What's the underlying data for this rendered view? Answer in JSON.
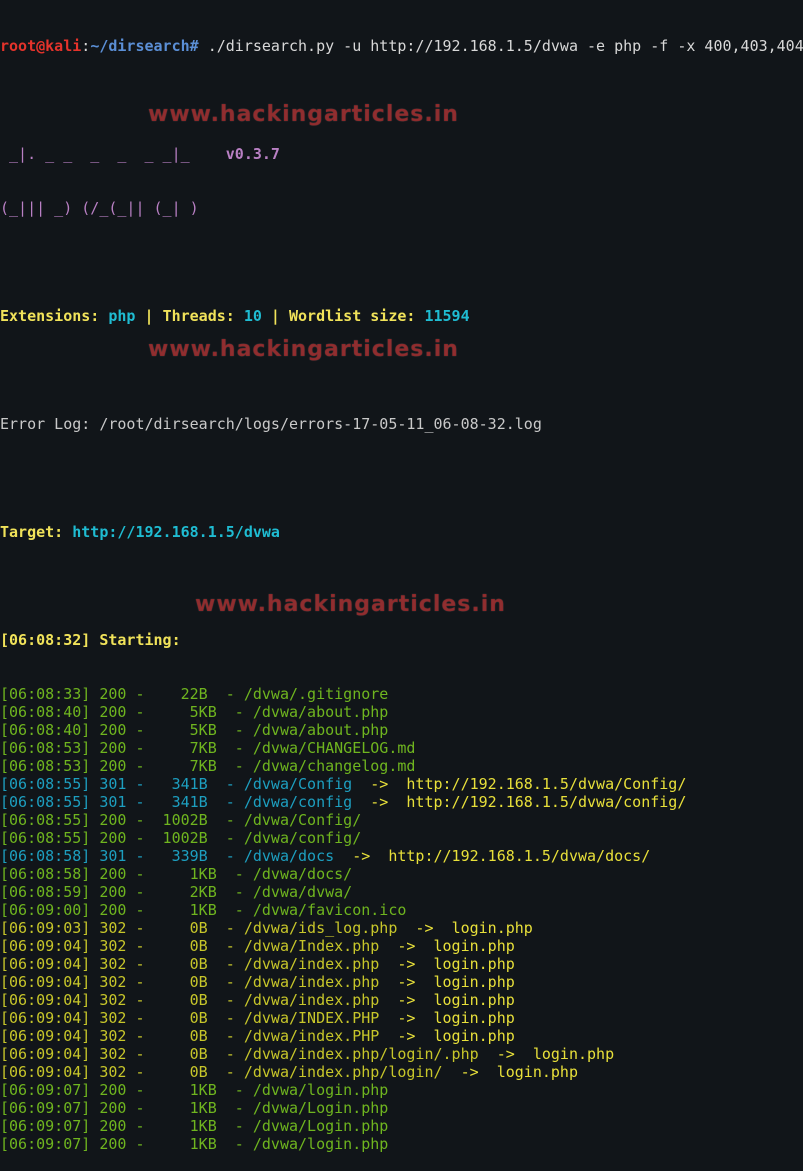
{
  "prompt": {
    "user": "root@kali",
    "sep": ":",
    "path": "~/dirsearch",
    "symbol": "#",
    "command": " ./dirsearch.py -u http://192.168.1.5/dvwa -e php -f -x 400,403,404"
  },
  "banner": {
    "line1": " _|. _ _  _  _  _ _|_    ",
    "line2": "(_||| _) (/_(_|| (_| )",
    "version": "v0.3.7"
  },
  "config": {
    "ext_label": "Extensions:",
    "ext_value": "php",
    "threads_label": "Threads:",
    "threads_value": "10",
    "wordlist_label": "Wordlist size:",
    "wordlist_value": "11594",
    "pipe": " | "
  },
  "error_log": "Error Log: /root/dirsearch/logs/errors-17-05-11_06-08-32.log",
  "target": {
    "label": "Target:",
    "url": "http://192.168.1.5/dvwa"
  },
  "starting": "[06:08:32] Starting:",
  "results": [
    {
      "time": "[06:08:33]",
      "code": "200",
      "size": "   22B",
      "path": "/dvwa/.gitignore",
      "redirect": ""
    },
    {
      "time": "[06:08:40]",
      "code": "200",
      "size": "    5KB",
      "path": "/dvwa/about.php",
      "redirect": ""
    },
    {
      "time": "[06:08:40]",
      "code": "200",
      "size": "    5KB",
      "path": "/dvwa/about.php",
      "redirect": ""
    },
    {
      "time": "[06:08:53]",
      "code": "200",
      "size": "    7KB",
      "path": "/dvwa/CHANGELOG.md",
      "redirect": ""
    },
    {
      "time": "[06:08:53]",
      "code": "200",
      "size": "    7KB",
      "path": "/dvwa/changelog.md",
      "redirect": ""
    },
    {
      "time": "[06:08:55]",
      "code": "301",
      "size": "  341B",
      "path": "/dvwa/Config",
      "redirect": "http://192.168.1.5/dvwa/Config/"
    },
    {
      "time": "[06:08:55]",
      "code": "301",
      "size": "  341B",
      "path": "/dvwa/config",
      "redirect": "http://192.168.1.5/dvwa/config/"
    },
    {
      "time": "[06:08:55]",
      "code": "200",
      "size": " 1002B",
      "path": "/dvwa/Config/",
      "redirect": ""
    },
    {
      "time": "[06:08:55]",
      "code": "200",
      "size": " 1002B",
      "path": "/dvwa/config/",
      "redirect": ""
    },
    {
      "time": "[06:08:58]",
      "code": "301",
      "size": "  339B",
      "path": "/dvwa/docs",
      "redirect": "http://192.168.1.5/dvwa/docs/"
    },
    {
      "time": "[06:08:58]",
      "code": "200",
      "size": "    1KB",
      "path": "/dvwa/docs/",
      "redirect": ""
    },
    {
      "time": "[06:08:59]",
      "code": "200",
      "size": "    2KB",
      "path": "/dvwa/dvwa/",
      "redirect": ""
    },
    {
      "time": "[06:09:00]",
      "code": "200",
      "size": "    1KB",
      "path": "/dvwa/favicon.ico",
      "redirect": ""
    },
    {
      "time": "[06:09:03]",
      "code": "302",
      "size": "    0B",
      "path": "/dvwa/ids_log.php",
      "redirect": "login.php"
    },
    {
      "time": "[06:09:04]",
      "code": "302",
      "size": "    0B",
      "path": "/dvwa/Index.php",
      "redirect": "login.php"
    },
    {
      "time": "[06:09:04]",
      "code": "302",
      "size": "    0B",
      "path": "/dvwa/index.php",
      "redirect": "login.php"
    },
    {
      "time": "[06:09:04]",
      "code": "302",
      "size": "    0B",
      "path": "/dvwa/index.php",
      "redirect": "login.php"
    },
    {
      "time": "[06:09:04]",
      "code": "302",
      "size": "    0B",
      "path": "/dvwa/index.php",
      "redirect": "login.php"
    },
    {
      "time": "[06:09:04]",
      "code": "302",
      "size": "    0B",
      "path": "/dvwa/INDEX.PHP",
      "redirect": "login.php"
    },
    {
      "time": "[06:09:04]",
      "code": "302",
      "size": "    0B",
      "path": "/dvwa/index.PHP",
      "redirect": "login.php"
    },
    {
      "time": "[06:09:04]",
      "code": "302",
      "size": "    0B",
      "path": "/dvwa/index.php/login/.php",
      "redirect": "login.php"
    },
    {
      "time": "[06:09:04]",
      "code": "302",
      "size": "    0B",
      "path": "/dvwa/index.php/login/",
      "redirect": "login.php"
    },
    {
      "time": "[06:09:07]",
      "code": "200",
      "size": "    1KB",
      "path": "/dvwa/login.php",
      "redirect": ""
    },
    {
      "time": "[06:09:07]",
      "code": "200",
      "size": "    1KB",
      "path": "/dvwa/Login.php",
      "redirect": ""
    },
    {
      "time": "[06:09:07]",
      "code": "200",
      "size": "    1KB",
      "path": "/dvwa/Login.php",
      "redirect": ""
    },
    {
      "time": "[06:09:07]",
      "code": "200",
      "size": "    1KB",
      "path": "/dvwa/login.php",
      "redirect": ""
    }
  ],
  "watermark": "www.hackingarticles.in",
  "colors": {
    "background": "#111519",
    "prompt_user": "#e5332b",
    "prompt_path": "#5b8fd6",
    "status_200": "#6fb51f",
    "status_301": "#1d9fc0",
    "status_302": "#c7c62a",
    "highlight": "#f1e35a",
    "accent": "#1fbcd2"
  }
}
